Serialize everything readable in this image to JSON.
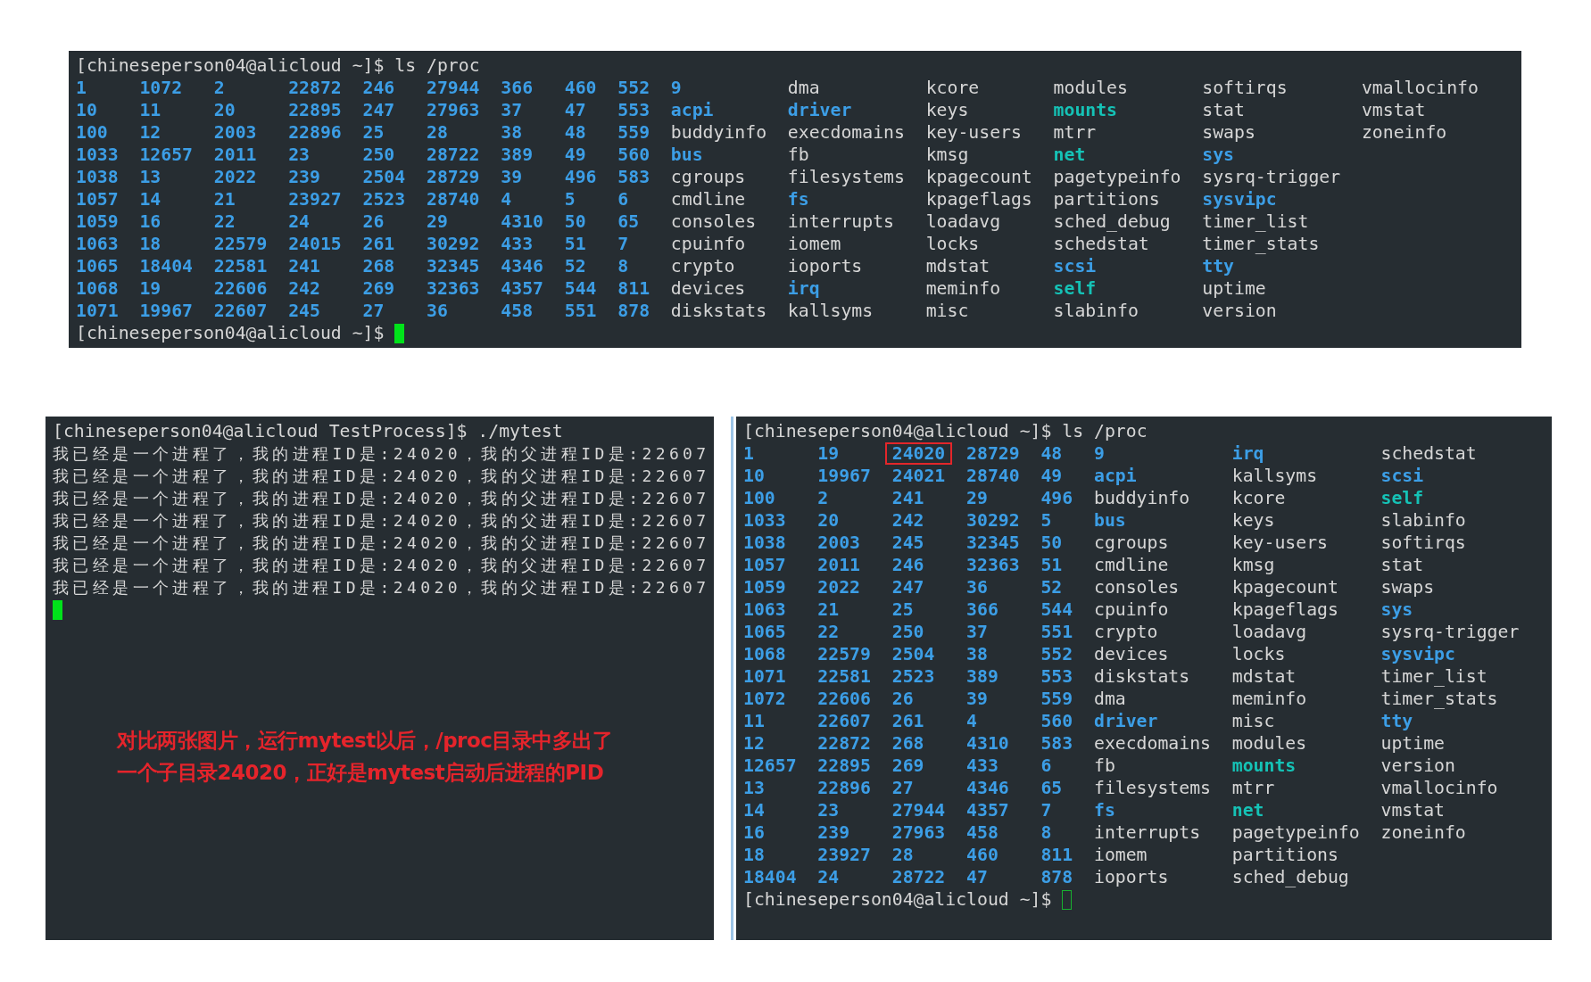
{
  "top_terminal": {
    "command": "[chineseperson04@alicloud ~]$ ls /proc",
    "columns": [
      [
        {
          "name": "1",
          "kind": "dir"
        },
        {
          "name": "10",
          "kind": "dir"
        },
        {
          "name": "100",
          "kind": "dir"
        },
        {
          "name": "1033",
          "kind": "dir"
        },
        {
          "name": "1038",
          "kind": "dir"
        },
        {
          "name": "1057",
          "kind": "dir"
        },
        {
          "name": "1059",
          "kind": "dir"
        },
        {
          "name": "1063",
          "kind": "dir"
        },
        {
          "name": "1065",
          "kind": "dir"
        },
        {
          "name": "1068",
          "kind": "dir"
        },
        {
          "name": "1071",
          "kind": "dir"
        }
      ],
      [
        {
          "name": "1072",
          "kind": "dir"
        },
        {
          "name": "11",
          "kind": "dir"
        },
        {
          "name": "12",
          "kind": "dir"
        },
        {
          "name": "12657",
          "kind": "dir"
        },
        {
          "name": "13",
          "kind": "dir"
        },
        {
          "name": "14",
          "kind": "dir"
        },
        {
          "name": "16",
          "kind": "dir"
        },
        {
          "name": "18",
          "kind": "dir"
        },
        {
          "name": "18404",
          "kind": "dir"
        },
        {
          "name": "19",
          "kind": "dir"
        },
        {
          "name": "19967",
          "kind": "dir"
        }
      ],
      [
        {
          "name": "2",
          "kind": "dir"
        },
        {
          "name": "20",
          "kind": "dir"
        },
        {
          "name": "2003",
          "kind": "dir"
        },
        {
          "name": "2011",
          "kind": "dir"
        },
        {
          "name": "2022",
          "kind": "dir"
        },
        {
          "name": "21",
          "kind": "dir"
        },
        {
          "name": "22",
          "kind": "dir"
        },
        {
          "name": "22579",
          "kind": "dir"
        },
        {
          "name": "22581",
          "kind": "dir"
        },
        {
          "name": "22606",
          "kind": "dir"
        },
        {
          "name": "22607",
          "kind": "dir"
        }
      ],
      [
        {
          "name": "22872",
          "kind": "dir"
        },
        {
          "name": "22895",
          "kind": "dir"
        },
        {
          "name": "22896",
          "kind": "dir"
        },
        {
          "name": "23",
          "kind": "dir"
        },
        {
          "name": "239",
          "kind": "dir"
        },
        {
          "name": "23927",
          "kind": "dir"
        },
        {
          "name": "24",
          "kind": "dir"
        },
        {
          "name": "24015",
          "kind": "dir"
        },
        {
          "name": "241",
          "kind": "dir"
        },
        {
          "name": "242",
          "kind": "dir"
        },
        {
          "name": "245",
          "kind": "dir"
        }
      ],
      [
        {
          "name": "246",
          "kind": "dir"
        },
        {
          "name": "247",
          "kind": "dir"
        },
        {
          "name": "25",
          "kind": "dir"
        },
        {
          "name": "250",
          "kind": "dir"
        },
        {
          "name": "2504",
          "kind": "dir"
        },
        {
          "name": "2523",
          "kind": "dir"
        },
        {
          "name": "26",
          "kind": "dir"
        },
        {
          "name": "261",
          "kind": "dir"
        },
        {
          "name": "268",
          "kind": "dir"
        },
        {
          "name": "269",
          "kind": "dir"
        },
        {
          "name": "27",
          "kind": "dir"
        }
      ],
      [
        {
          "name": "27944",
          "kind": "dir"
        },
        {
          "name": "27963",
          "kind": "dir"
        },
        {
          "name": "28",
          "kind": "dir"
        },
        {
          "name": "28722",
          "kind": "dir"
        },
        {
          "name": "28729",
          "kind": "dir"
        },
        {
          "name": "28740",
          "kind": "dir"
        },
        {
          "name": "29",
          "kind": "dir"
        },
        {
          "name": "30292",
          "kind": "dir"
        },
        {
          "name": "32345",
          "kind": "dir"
        },
        {
          "name": "32363",
          "kind": "dir"
        },
        {
          "name": "36",
          "kind": "dir"
        }
      ],
      [
        {
          "name": "366",
          "kind": "dir"
        },
        {
          "name": "37",
          "kind": "dir"
        },
        {
          "name": "38",
          "kind": "dir"
        },
        {
          "name": "389",
          "kind": "dir"
        },
        {
          "name": "39",
          "kind": "dir"
        },
        {
          "name": "4",
          "kind": "dir"
        },
        {
          "name": "4310",
          "kind": "dir"
        },
        {
          "name": "433",
          "kind": "dir"
        },
        {
          "name": "4346",
          "kind": "dir"
        },
        {
          "name": "4357",
          "kind": "dir"
        },
        {
          "name": "458",
          "kind": "dir"
        }
      ],
      [
        {
          "name": "460",
          "kind": "dir"
        },
        {
          "name": "47",
          "kind": "dir"
        },
        {
          "name": "48",
          "kind": "dir"
        },
        {
          "name": "49",
          "kind": "dir"
        },
        {
          "name": "496",
          "kind": "dir"
        },
        {
          "name": "5",
          "kind": "dir"
        },
        {
          "name": "50",
          "kind": "dir"
        },
        {
          "name": "51",
          "kind": "dir"
        },
        {
          "name": "52",
          "kind": "dir"
        },
        {
          "name": "544",
          "kind": "dir"
        },
        {
          "name": "551",
          "kind": "dir"
        }
      ],
      [
        {
          "name": "552",
          "kind": "dir"
        },
        {
          "name": "553",
          "kind": "dir"
        },
        {
          "name": "559",
          "kind": "dir"
        },
        {
          "name": "560",
          "kind": "dir"
        },
        {
          "name": "583",
          "kind": "dir"
        },
        {
          "name": "6",
          "kind": "dir"
        },
        {
          "name": "65",
          "kind": "dir"
        },
        {
          "name": "7",
          "kind": "dir"
        },
        {
          "name": "8",
          "kind": "dir"
        },
        {
          "name": "811",
          "kind": "dir"
        },
        {
          "name": "878",
          "kind": "dir"
        }
      ],
      [
        {
          "name": "9",
          "kind": "dir"
        },
        {
          "name": "acpi",
          "kind": "dir"
        },
        {
          "name": "buddyinfo",
          "kind": "file"
        },
        {
          "name": "bus",
          "kind": "dir"
        },
        {
          "name": "cgroups",
          "kind": "file"
        },
        {
          "name": "cmdline",
          "kind": "file"
        },
        {
          "name": "consoles",
          "kind": "file"
        },
        {
          "name": "cpuinfo",
          "kind": "file"
        },
        {
          "name": "crypto",
          "kind": "file"
        },
        {
          "name": "devices",
          "kind": "file"
        },
        {
          "name": "diskstats",
          "kind": "file"
        }
      ],
      [
        {
          "name": "dma",
          "kind": "file"
        },
        {
          "name": "driver",
          "kind": "dir"
        },
        {
          "name": "execdomains",
          "kind": "file"
        },
        {
          "name": "fb",
          "kind": "file"
        },
        {
          "name": "filesystems",
          "kind": "file"
        },
        {
          "name": "fs",
          "kind": "dir"
        },
        {
          "name": "interrupts",
          "kind": "file"
        },
        {
          "name": "iomem",
          "kind": "file"
        },
        {
          "name": "ioports",
          "kind": "file"
        },
        {
          "name": "irq",
          "kind": "dir"
        },
        {
          "name": "kallsyms",
          "kind": "file"
        }
      ],
      [
        {
          "name": "kcore",
          "kind": "file"
        },
        {
          "name": "keys",
          "kind": "file"
        },
        {
          "name": "key-users",
          "kind": "file"
        },
        {
          "name": "kmsg",
          "kind": "file"
        },
        {
          "name": "kpagecount",
          "kind": "file"
        },
        {
          "name": "kpageflags",
          "kind": "file"
        },
        {
          "name": "loadavg",
          "kind": "file"
        },
        {
          "name": "locks",
          "kind": "file"
        },
        {
          "name": "mdstat",
          "kind": "file"
        },
        {
          "name": "meminfo",
          "kind": "file"
        },
        {
          "name": "misc",
          "kind": "file"
        }
      ],
      [
        {
          "name": "modules",
          "kind": "file"
        },
        {
          "name": "mounts",
          "kind": "link"
        },
        {
          "name": "mtrr",
          "kind": "file"
        },
        {
          "name": "net",
          "kind": "link"
        },
        {
          "name": "pagetypeinfo",
          "kind": "file"
        },
        {
          "name": "partitions",
          "kind": "file"
        },
        {
          "name": "sched_debug",
          "kind": "file"
        },
        {
          "name": "schedstat",
          "kind": "file"
        },
        {
          "name": "scsi",
          "kind": "dir"
        },
        {
          "name": "self",
          "kind": "link"
        },
        {
          "name": "slabinfo",
          "kind": "file"
        }
      ],
      [
        {
          "name": "softirqs",
          "kind": "file"
        },
        {
          "name": "stat",
          "kind": "file"
        },
        {
          "name": "swaps",
          "kind": "file"
        },
        {
          "name": "sys",
          "kind": "dir"
        },
        {
          "name": "sysrq-trigger",
          "kind": "file"
        },
        {
          "name": "sysvipc",
          "kind": "dir"
        },
        {
          "name": "timer_list",
          "kind": "file"
        },
        {
          "name": "timer_stats",
          "kind": "file"
        },
        {
          "name": "tty",
          "kind": "dir"
        },
        {
          "name": "uptime",
          "kind": "file"
        },
        {
          "name": "version",
          "kind": "file"
        }
      ],
      [
        {
          "name": "vmallocinfo",
          "kind": "file"
        },
        {
          "name": "vmstat",
          "kind": "file"
        },
        {
          "name": "zoneinfo",
          "kind": "file"
        }
      ]
    ],
    "prompt": "[chineseperson04@alicloud ~]$",
    "cursor_filled": true
  },
  "left_terminal": {
    "command": "[chineseperson04@alicloud TestProcess]$ ./mytest",
    "output": [
      "我已经是一个进程了，我的进程ID是:24020，我的父进程ID是:22607",
      "我已经是一个进程了，我的进程ID是:24020，我的父进程ID是:22607",
      "我已经是一个进程了，我的进程ID是:24020，我的父进程ID是:22607",
      "我已经是一个进程了，我的进程ID是:24020，我的父进程ID是:22607",
      "我已经是一个进程了，我的进程ID是:24020，我的父进程ID是:22607",
      "我已经是一个进程了，我的进程ID是:24020，我的父进程ID是:22607",
      "我已经是一个进程了，我的进程ID是:24020，我的父进程ID是:22607"
    ],
    "cursor_filled": true,
    "annotation": [
      "对比两张图片，运行mytest以后，/proc目录中多出了",
      "一个子目录24020，正好是mytest启动后进程的PID"
    ]
  },
  "right_terminal": {
    "command": "[chineseperson04@alicloud ~]$ ls /proc",
    "columns": [
      [
        {
          "name": "1",
          "kind": "dir"
        },
        {
          "name": "10",
          "kind": "dir"
        },
        {
          "name": "100",
          "kind": "dir"
        },
        {
          "name": "1033",
          "kind": "dir"
        },
        {
          "name": "1038",
          "kind": "dir"
        },
        {
          "name": "1057",
          "kind": "dir"
        },
        {
          "name": "1059",
          "kind": "dir"
        },
        {
          "name": "1063",
          "kind": "dir"
        },
        {
          "name": "1065",
          "kind": "dir"
        },
        {
          "name": "1068",
          "kind": "dir"
        },
        {
          "name": "1071",
          "kind": "dir"
        },
        {
          "name": "1072",
          "kind": "dir"
        },
        {
          "name": "11",
          "kind": "dir"
        },
        {
          "name": "12",
          "kind": "dir"
        },
        {
          "name": "12657",
          "kind": "dir"
        },
        {
          "name": "13",
          "kind": "dir"
        },
        {
          "name": "14",
          "kind": "dir"
        },
        {
          "name": "16",
          "kind": "dir"
        },
        {
          "name": "18",
          "kind": "dir"
        },
        {
          "name": "18404",
          "kind": "dir"
        }
      ],
      [
        {
          "name": "19",
          "kind": "dir"
        },
        {
          "name": "19967",
          "kind": "dir"
        },
        {
          "name": "2",
          "kind": "dir"
        },
        {
          "name": "20",
          "kind": "dir"
        },
        {
          "name": "2003",
          "kind": "dir"
        },
        {
          "name": "2011",
          "kind": "dir"
        },
        {
          "name": "2022",
          "kind": "dir"
        },
        {
          "name": "21",
          "kind": "dir"
        },
        {
          "name": "22",
          "kind": "dir"
        },
        {
          "name": "22579",
          "kind": "dir"
        },
        {
          "name": "22581",
          "kind": "dir"
        },
        {
          "name": "22606",
          "kind": "dir"
        },
        {
          "name": "22607",
          "kind": "dir"
        },
        {
          "name": "22872",
          "kind": "dir"
        },
        {
          "name": "22895",
          "kind": "dir"
        },
        {
          "name": "22896",
          "kind": "dir"
        },
        {
          "name": "23",
          "kind": "dir"
        },
        {
          "name": "239",
          "kind": "dir"
        },
        {
          "name": "23927",
          "kind": "dir"
        },
        {
          "name": "24",
          "kind": "dir"
        }
      ],
      [
        {
          "name": "24020",
          "kind": "highlighted_dir"
        },
        {
          "name": "24021",
          "kind": "dir"
        },
        {
          "name": "241",
          "kind": "dir"
        },
        {
          "name": "242",
          "kind": "dir"
        },
        {
          "name": "245",
          "kind": "dir"
        },
        {
          "name": "246",
          "kind": "dir"
        },
        {
          "name": "247",
          "kind": "dir"
        },
        {
          "name": "25",
          "kind": "dir"
        },
        {
          "name": "250",
          "kind": "dir"
        },
        {
          "name": "2504",
          "kind": "dir"
        },
        {
          "name": "2523",
          "kind": "dir"
        },
        {
          "name": "26",
          "kind": "dir"
        },
        {
          "name": "261",
          "kind": "dir"
        },
        {
          "name": "268",
          "kind": "dir"
        },
        {
          "name": "269",
          "kind": "dir"
        },
        {
          "name": "27",
          "kind": "dir"
        },
        {
          "name": "27944",
          "kind": "dir"
        },
        {
          "name": "27963",
          "kind": "dir"
        },
        {
          "name": "28",
          "kind": "dir"
        },
        {
          "name": "28722",
          "kind": "dir"
        }
      ],
      [
        {
          "name": "28729",
          "kind": "dir"
        },
        {
          "name": "28740",
          "kind": "dir"
        },
        {
          "name": "29",
          "kind": "dir"
        },
        {
          "name": "30292",
          "kind": "dir"
        },
        {
          "name": "32345",
          "kind": "dir"
        },
        {
          "name": "32363",
          "kind": "dir"
        },
        {
          "name": "36",
          "kind": "dir"
        },
        {
          "name": "366",
          "kind": "dir"
        },
        {
          "name": "37",
          "kind": "dir"
        },
        {
          "name": "38",
          "kind": "dir"
        },
        {
          "name": "389",
          "kind": "dir"
        },
        {
          "name": "39",
          "kind": "dir"
        },
        {
          "name": "4",
          "kind": "dir"
        },
        {
          "name": "4310",
          "kind": "dir"
        },
        {
          "name": "433",
          "kind": "dir"
        },
        {
          "name": "4346",
          "kind": "dir"
        },
        {
          "name": "4357",
          "kind": "dir"
        },
        {
          "name": "458",
          "kind": "dir"
        },
        {
          "name": "460",
          "kind": "dir"
        },
        {
          "name": "47",
          "kind": "dir"
        }
      ],
      [
        {
          "name": "48",
          "kind": "dir"
        },
        {
          "name": "49",
          "kind": "dir"
        },
        {
          "name": "496",
          "kind": "dir"
        },
        {
          "name": "5",
          "kind": "dir"
        },
        {
          "name": "50",
          "kind": "dir"
        },
        {
          "name": "51",
          "kind": "dir"
        },
        {
          "name": "52",
          "kind": "dir"
        },
        {
          "name": "544",
          "kind": "dir"
        },
        {
          "name": "551",
          "kind": "dir"
        },
        {
          "name": "552",
          "kind": "dir"
        },
        {
          "name": "553",
          "kind": "dir"
        },
        {
          "name": "559",
          "kind": "dir"
        },
        {
          "name": "560",
          "kind": "dir"
        },
        {
          "name": "583",
          "kind": "dir"
        },
        {
          "name": "6",
          "kind": "dir"
        },
        {
          "name": "65",
          "kind": "dir"
        },
        {
          "name": "7",
          "kind": "dir"
        },
        {
          "name": "8",
          "kind": "dir"
        },
        {
          "name": "811",
          "kind": "dir"
        },
        {
          "name": "878",
          "kind": "dir"
        }
      ],
      [
        {
          "name": "9",
          "kind": "dir"
        },
        {
          "name": "acpi",
          "kind": "dir"
        },
        {
          "name": "buddyinfo",
          "kind": "file"
        },
        {
          "name": "bus",
          "kind": "dir"
        },
        {
          "name": "cgroups",
          "kind": "file"
        },
        {
          "name": "cmdline",
          "kind": "file"
        },
        {
          "name": "consoles",
          "kind": "file"
        },
        {
          "name": "cpuinfo",
          "kind": "file"
        },
        {
          "name": "crypto",
          "kind": "file"
        },
        {
          "name": "devices",
          "kind": "file"
        },
        {
          "name": "diskstats",
          "kind": "file"
        },
        {
          "name": "dma",
          "kind": "file"
        },
        {
          "name": "driver",
          "kind": "dir"
        },
        {
          "name": "execdomains",
          "kind": "file"
        },
        {
          "name": "fb",
          "kind": "file"
        },
        {
          "name": "filesystems",
          "kind": "file"
        },
        {
          "name": "fs",
          "kind": "dir"
        },
        {
          "name": "interrupts",
          "kind": "file"
        },
        {
          "name": "iomem",
          "kind": "file"
        },
        {
          "name": "ioports",
          "kind": "file"
        }
      ],
      [
        {
          "name": "irq",
          "kind": "dir"
        },
        {
          "name": "kallsyms",
          "kind": "file"
        },
        {
          "name": "kcore",
          "kind": "file"
        },
        {
          "name": "keys",
          "kind": "file"
        },
        {
          "name": "key-users",
          "kind": "file"
        },
        {
          "name": "kmsg",
          "kind": "file"
        },
        {
          "name": "kpagecount",
          "kind": "file"
        },
        {
          "name": "kpageflags",
          "kind": "file"
        },
        {
          "name": "loadavg",
          "kind": "file"
        },
        {
          "name": "locks",
          "kind": "file"
        },
        {
          "name": "mdstat",
          "kind": "file"
        },
        {
          "name": "meminfo",
          "kind": "file"
        },
        {
          "name": "misc",
          "kind": "file"
        },
        {
          "name": "modules",
          "kind": "file"
        },
        {
          "name": "mounts",
          "kind": "link"
        },
        {
          "name": "mtrr",
          "kind": "file"
        },
        {
          "name": "net",
          "kind": "link"
        },
        {
          "name": "pagetypeinfo",
          "kind": "file"
        },
        {
          "name": "partitions",
          "kind": "file"
        },
        {
          "name": "sched_debug",
          "kind": "file"
        }
      ],
      [
        {
          "name": "schedstat",
          "kind": "file"
        },
        {
          "name": "scsi",
          "kind": "dir"
        },
        {
          "name": "self",
          "kind": "link"
        },
        {
          "name": "slabinfo",
          "kind": "file"
        },
        {
          "name": "softirqs",
          "kind": "file"
        },
        {
          "name": "stat",
          "kind": "file"
        },
        {
          "name": "swaps",
          "kind": "file"
        },
        {
          "name": "sys",
          "kind": "dir"
        },
        {
          "name": "sysrq-trigger",
          "kind": "file"
        },
        {
          "name": "sysvipc",
          "kind": "dir"
        },
        {
          "name": "timer_list",
          "kind": "file"
        },
        {
          "name": "timer_stats",
          "kind": "file"
        },
        {
          "name": "tty",
          "kind": "dir"
        },
        {
          "name": "uptime",
          "kind": "file"
        },
        {
          "name": "version",
          "kind": "file"
        },
        {
          "name": "vmallocinfo",
          "kind": "file"
        },
        {
          "name": "vmstat",
          "kind": "file"
        },
        {
          "name": "zoneinfo",
          "kind": "file"
        }
      ]
    ],
    "prompt": "[chineseperson04@alicloud ~]$",
    "cursor_filled": false
  }
}
